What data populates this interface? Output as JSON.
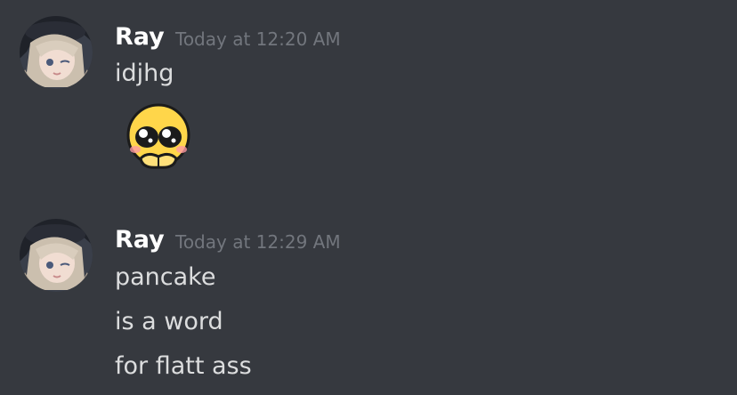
{
  "messages": [
    {
      "author": "Ray",
      "timestamp": "Today at 12:20 AM",
      "lines": [
        "idjhg"
      ],
      "avatar_icon": "anime-girl-avatar-icon",
      "attachment_icon": "pleading-emoji-icon"
    },
    {
      "author": "Ray",
      "timestamp": "Today at 12:29 AM",
      "lines": [
        "pancake",
        "is a word",
        "for flatt ass"
      ],
      "avatar_icon": "anime-girl-avatar-icon"
    }
  ],
  "colors": {
    "background": "#36393f",
    "author": "#ffffff",
    "timestamp": "#72767d",
    "message_text": "#dcddde"
  }
}
